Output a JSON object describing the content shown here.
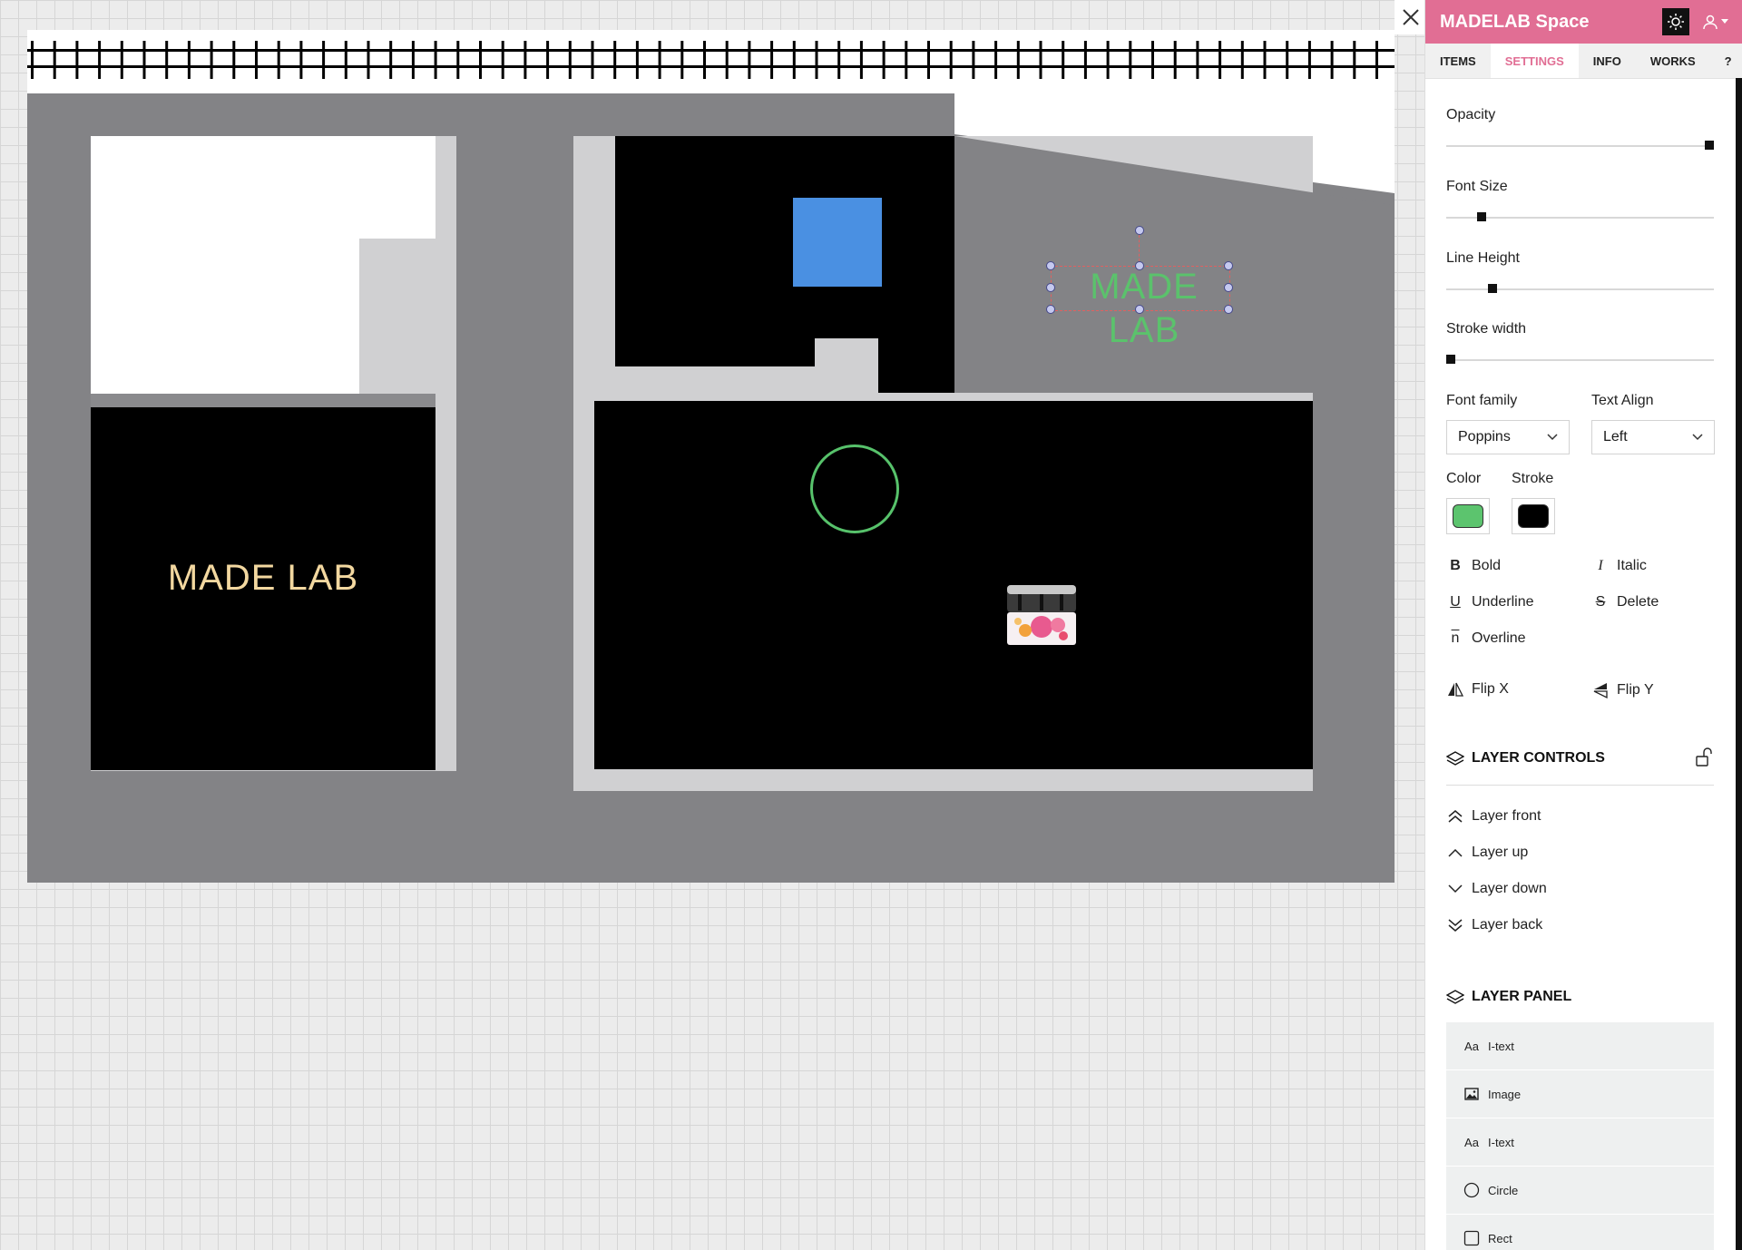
{
  "canvas": {
    "left_text": "MADE LAB",
    "selected_text": "MADE LAB"
  },
  "panel": {
    "title": "MADELAB Space",
    "tabs": [
      {
        "label": "ITEMS"
      },
      {
        "label": "SETTINGS"
      },
      {
        "label": "INFO"
      },
      {
        "label": "WORKS"
      },
      {
        "label": "?"
      }
    ],
    "active_tab": "SETTINGS",
    "settings": {
      "opacity": {
        "label": "Opacity",
        "value": 1.0
      },
      "font_size": {
        "label": "Font Size",
        "value": 0.12
      },
      "line_height": {
        "label": "Line Height",
        "value": 0.16
      },
      "stroke_width": {
        "label": "Stroke width",
        "value": 0.0
      },
      "font_family": {
        "label": "Font family",
        "value": "Poppins"
      },
      "text_align": {
        "label": "Text Align",
        "value": "Left"
      },
      "color": {
        "label": "Color",
        "value": "#5cc46e"
      },
      "stroke": {
        "label": "Stroke",
        "value": "#000000"
      }
    },
    "text_styles": {
      "bold": "Bold",
      "italic": "Italic",
      "underline": "Underline",
      "delete": "Delete",
      "overline": "Overline",
      "flip_x": "Flip X",
      "flip_y": "Flip Y"
    },
    "layer_controls": {
      "title": "LAYER CONTROLS",
      "front": "Layer front",
      "up": "Layer up",
      "down": "Layer down",
      "back": "Layer back"
    },
    "layer_panel": {
      "title": "LAYER PANEL",
      "items": [
        {
          "label": "I-text",
          "icon": "text-icon"
        },
        {
          "label": "Image",
          "icon": "image-icon"
        },
        {
          "label": "I-text",
          "icon": "text-icon"
        },
        {
          "label": "Circle",
          "icon": "circle-icon"
        },
        {
          "label": "Rect",
          "icon": "rect-icon"
        }
      ]
    }
  }
}
